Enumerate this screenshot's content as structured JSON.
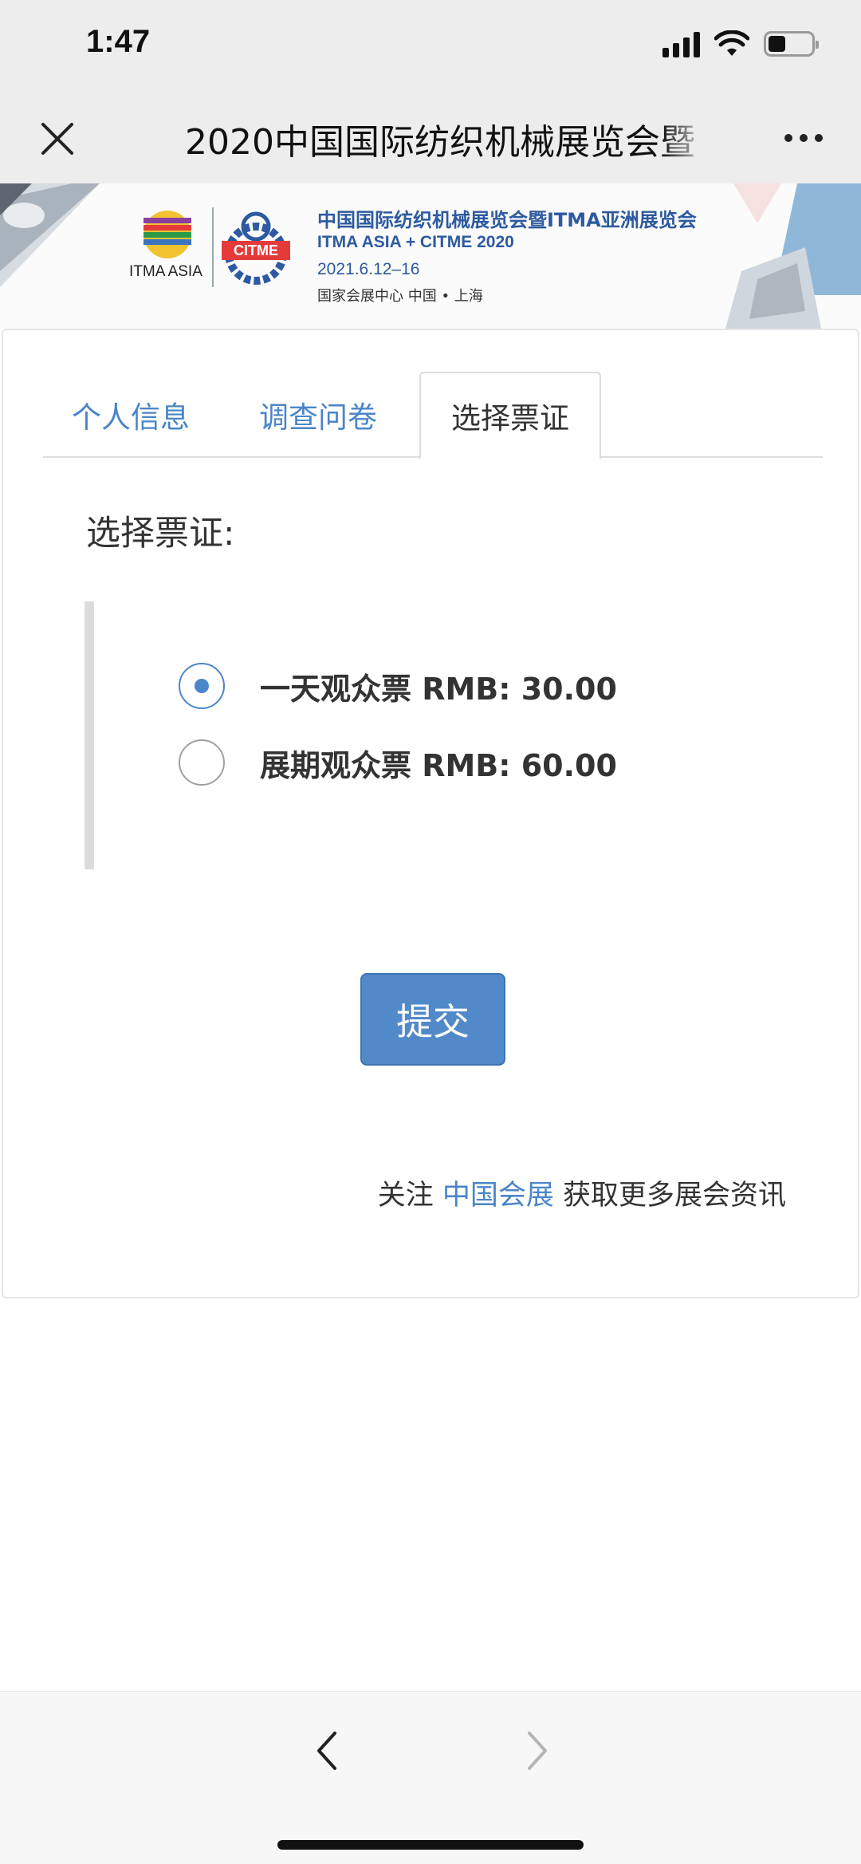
{
  "status_bar": {
    "time": "1:47"
  },
  "nav": {
    "title": "2020中国国际纺织机械展览会暨",
    "close_icon": "close-icon",
    "more_icon": "more-icon"
  },
  "banner": {
    "itma_logo_text": "ITMA ASIA",
    "citme_logo_text": "CITME",
    "title_cn": "中国国际纺织机械展览会暨ITMA亚洲展览会",
    "title_en": "ITMA ASIA + CITME 2020",
    "date": "2021.6.12–16",
    "venue": "国家会展中心   中国 • 上海"
  },
  "tabs": [
    {
      "label": "个人信息",
      "active": false
    },
    {
      "label": "调查问卷",
      "active": false
    },
    {
      "label": "选择票证",
      "active": true
    }
  ],
  "form": {
    "section_label": "选择票证:",
    "options": [
      {
        "label": "一天观众票 RMB: 30.00",
        "checked": true
      },
      {
        "label": "展期观众票 RMB: 60.00",
        "checked": false
      }
    ],
    "submit_label": "提交"
  },
  "footer": {
    "prefix": "关注 ",
    "link": "中国会展",
    "suffix": " 获取更多展会资讯"
  },
  "colors": {
    "accent": "#4a86c8",
    "button": "#5289c9",
    "banner_text": "#2d5aa0"
  }
}
